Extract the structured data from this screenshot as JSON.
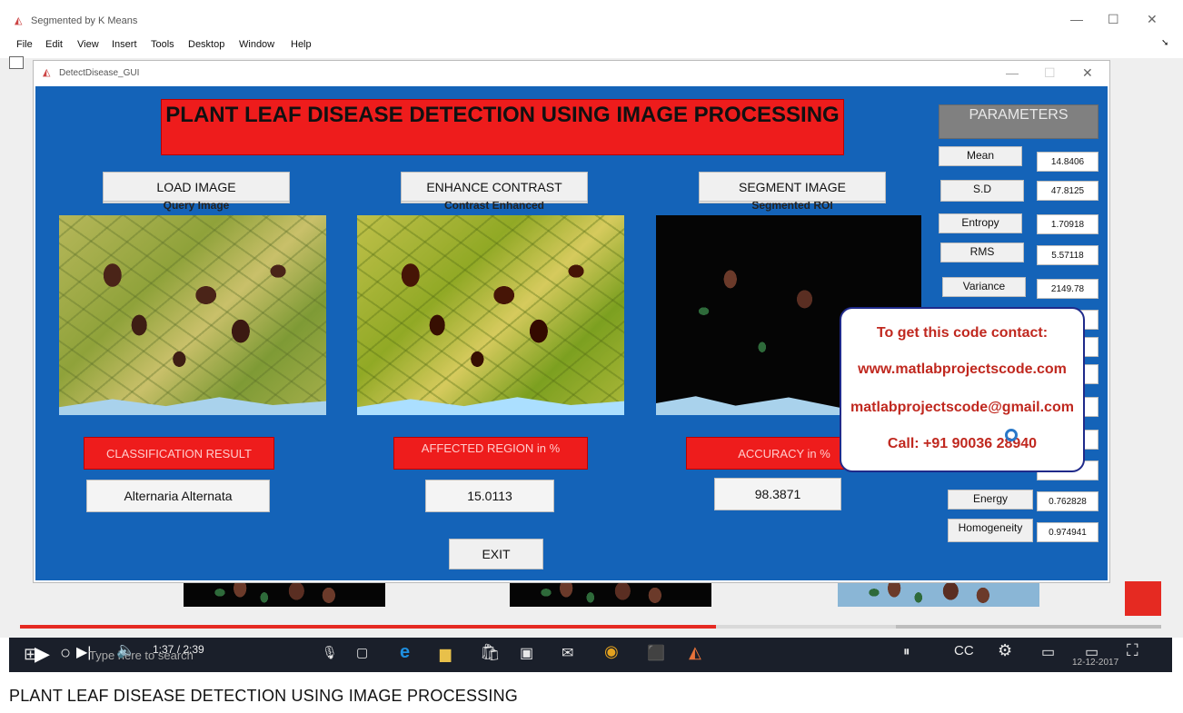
{
  "outer_window": {
    "title": "Segmented by K Means",
    "menu": [
      "File",
      "Edit",
      "View",
      "Insert",
      "Tools",
      "Desktop",
      "Window",
      "Help"
    ]
  },
  "gui_window": {
    "title": "DetectDisease_GUI",
    "heading": "PLANT LEAF DISEASE DETECTION USING IMAGE PROCESSING",
    "buttons": {
      "load": "LOAD IMAGE",
      "enhance": "ENHANCE CONTRAST",
      "segment": "SEGMENT IMAGE",
      "exit": "EXIT"
    },
    "image_labels": {
      "query": "Query Image",
      "contrast": "Contrast Enhanced",
      "segmented": "Segmented ROI"
    },
    "results": {
      "classification_label": "CLASSIFICATION RESULT",
      "classification_value": "Alternaria Alternata",
      "affected_label": "AFFECTED REGION in %",
      "affected_value": "15.0113",
      "accuracy_label": "ACCURACY in %",
      "accuracy_value": "98.3871"
    },
    "parameters": {
      "title": "PARAMETERS",
      "rows": [
        {
          "label": "Mean",
          "value": "14.8406"
        },
        {
          "label": "S.D",
          "value": "47.8125"
        },
        {
          "label": "Entropy",
          "value": "1.70918"
        },
        {
          "label": "RMS",
          "value": "5.57118"
        },
        {
          "label": "Variance",
          "value": "2149.78"
        },
        {
          "label": "Energy",
          "value": "0.762828"
        },
        {
          "label": "Homogeneity",
          "value": "0.974941"
        }
      ]
    }
  },
  "popup": {
    "line1": "To get this code contact:",
    "line2": "www.matlabprojectscode.com",
    "line3": "matlabprojectscode@gmail.com",
    "line4": "Call: +91 90036 28940"
  },
  "player": {
    "time": "1:37 / 2:39",
    "search_placeholder": "Type here to search",
    "date": "12-12-2017",
    "progress": 0.61
  },
  "video_title": "PLANT LEAF DISEASE DETECTION USING IMAGE PROCESSING"
}
